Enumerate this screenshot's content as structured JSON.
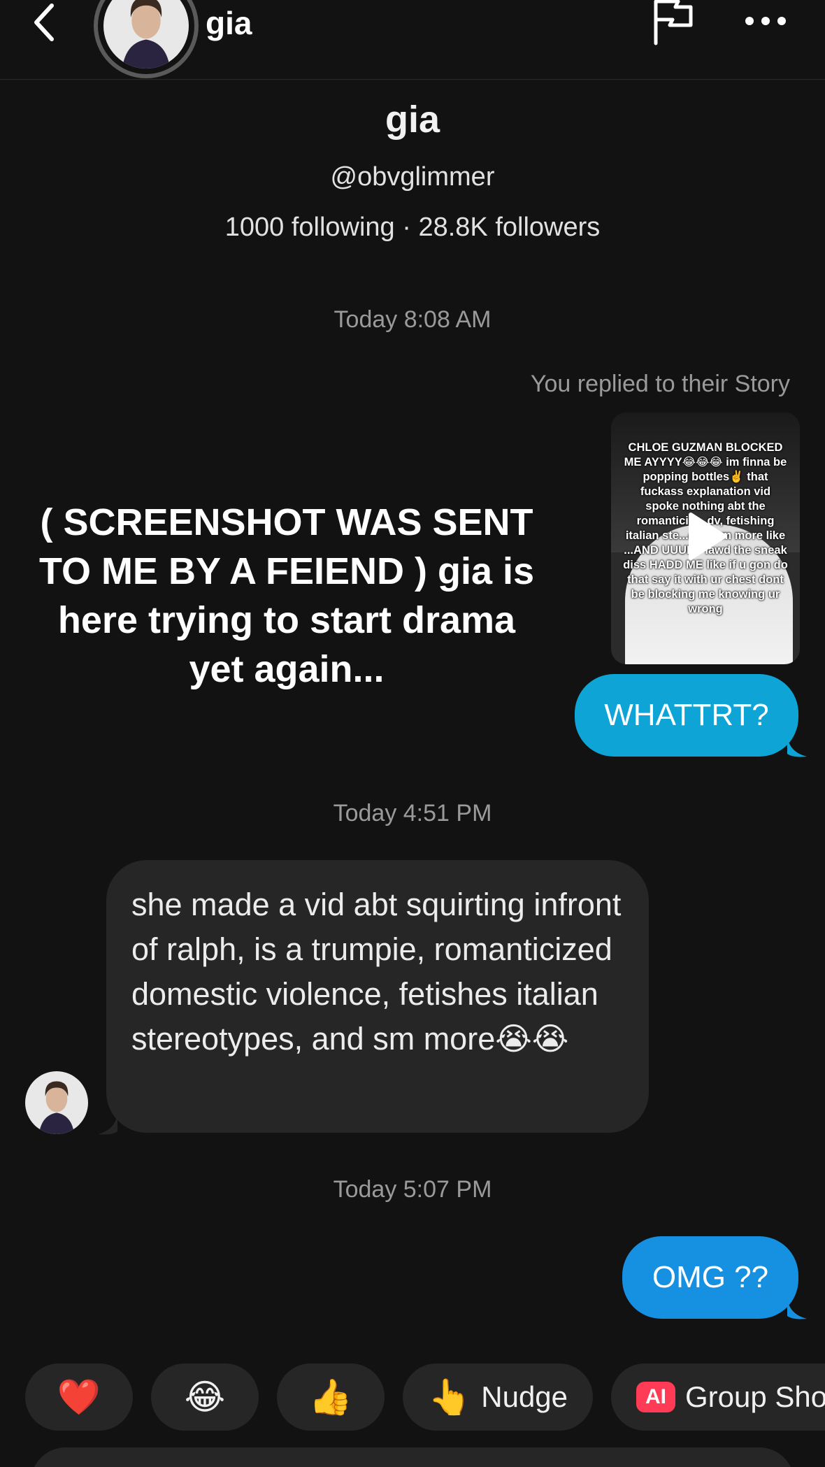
{
  "header": {
    "name": "gia",
    "back_icon": "chevron-left-icon",
    "flag_icon": "flag-icon",
    "more_icon": "more-horizontal-icon"
  },
  "profile": {
    "name": "gia",
    "handle": "@obvglimmer",
    "stats": "1000 following · 28.8K followers"
  },
  "messages": {
    "ts1": "Today 8:08 AM",
    "story_reply_label": "You replied to their Story",
    "story_caption": "CHLOE GUZMAN BLOCKED ME AYYYY😂😂😂 im finna be popping bottles✌️ that fuckass explanation vid spoke nothing abt the romanticiz... dv, fetishing italian ste...es n sm more like ...AND UUUPP lawd the sneak diss HADD ME like if u gon do that say it with ur chest dont be blocking me knowing ur wrong",
    "out1": "WHATTRT?",
    "ts2": "Today 4:51 PM",
    "in1": "she made a vid abt squirting infront of ralph, is a trumpie, romanticized domestic violence, fetishes italian stereotypes, and sm more😭😭",
    "ts3": "Today 5:07 PM",
    "out2": "OMG ??"
  },
  "overlay": {
    "text": "( SCREENSHOT WAS SENT TO ME BY A FEIEND ) gia is here trying to start drama yet again..."
  },
  "quick_reactions": [
    {
      "emoji": "❤️",
      "label": ""
    },
    {
      "emoji": "😂",
      "label": ""
    },
    {
      "emoji": "👍",
      "label": ""
    },
    {
      "emoji": "👆",
      "label": "Nudge"
    },
    {
      "badge": "AI",
      "label": "Group Sho"
    }
  ],
  "colors": {
    "background": "#121212",
    "bubble_out_1": "#0ea5d6",
    "bubble_out_2": "#1690e0",
    "bubble_in": "#262626",
    "ai_badge": "#ff3b55"
  }
}
